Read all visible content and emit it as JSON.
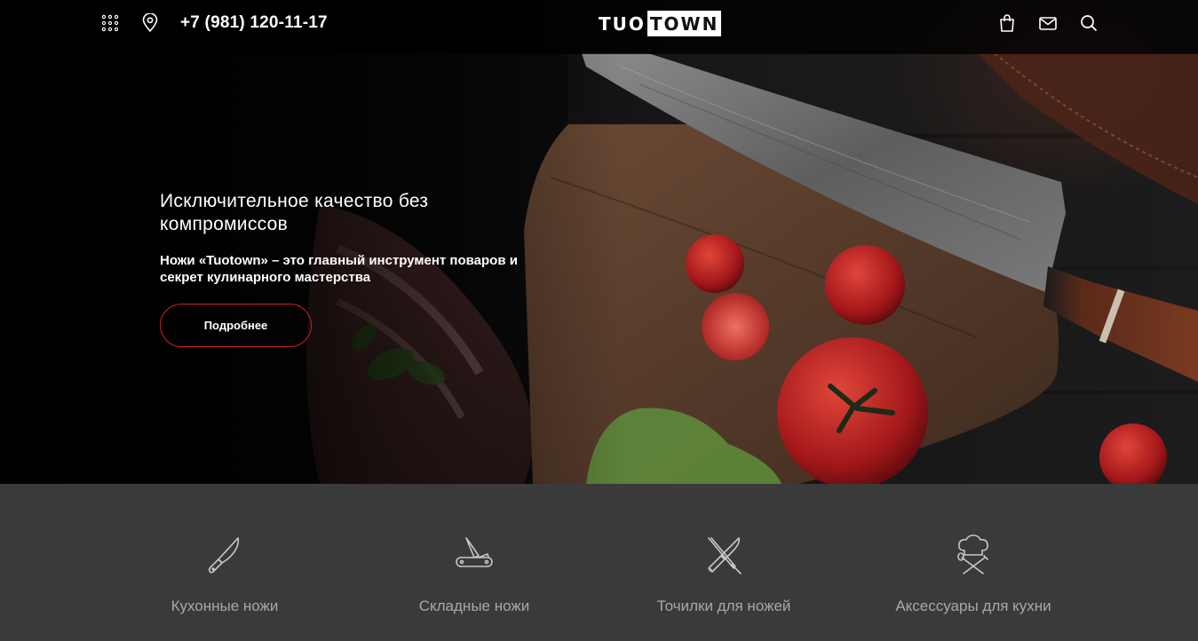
{
  "header": {
    "phone": "+7 (981) 120-11-17",
    "logo_left": "TUO",
    "logo_right": "TOWN",
    "icons": [
      "grid-menu-icon",
      "map-pin-icon",
      "shopping-bag-icon",
      "mail-icon",
      "search-icon"
    ]
  },
  "hero": {
    "title": "Исключительное качество без компромиссов",
    "subtitle": "Ножи «Tuotown» – это главный инструмент поваров и секрет кулинарного мастерства",
    "button_label": "Подробнее"
  },
  "categories": [
    {
      "label": "Кухонные ножи",
      "icon": "chef-knife-icon"
    },
    {
      "label": "Складные ножи",
      "icon": "folding-knife-icon"
    },
    {
      "label": "Точилки для ножей",
      "icon": "knife-sharpener-icon"
    },
    {
      "label": "Аксессуары для кухни",
      "icon": "chef-hat-icon"
    }
  ],
  "colors": {
    "accent": "#c8232a",
    "topbar": "#0b0b0b",
    "strip": "#3a3a3a",
    "category_text": "#a8a8a8"
  }
}
